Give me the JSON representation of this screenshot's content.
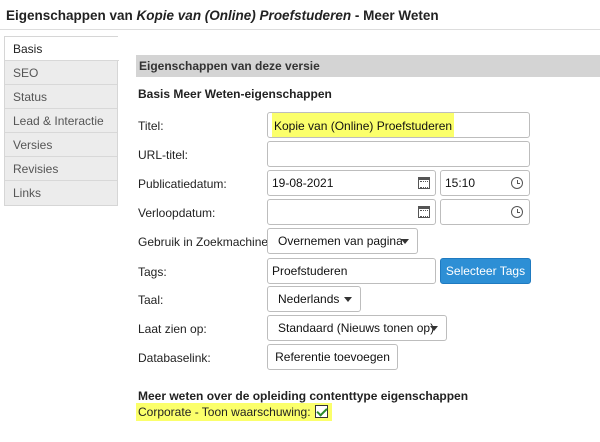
{
  "window": {
    "title_prefix": "Eigenschappen van ",
    "title_italic": "Kopie van (Online) Proefstuderen",
    "title_suffix": " - Meer Weten"
  },
  "sidebar": {
    "items": [
      {
        "label": "Basis",
        "active": true
      },
      {
        "label": "SEO",
        "active": false
      },
      {
        "label": "Status",
        "active": false
      },
      {
        "label": "Lead & Interactie",
        "active": false
      },
      {
        "label": "Versies",
        "active": false
      },
      {
        "label": "Revisies",
        "active": false
      },
      {
        "label": "Links",
        "active": false
      }
    ]
  },
  "main": {
    "section_header": "Eigenschappen van deze versie",
    "subheading": "Basis Meer Weten-eigenschappen",
    "fields": {
      "titel": {
        "label": "Titel:",
        "value": "Kopie van (Online) Proefstuderen"
      },
      "url_titel": {
        "label": "URL-titel:",
        "value": ""
      },
      "publicatiedatum": {
        "label": "Publicatiedatum:",
        "date": "19-08-2021",
        "time": "15:10"
      },
      "verloopdatum": {
        "label": "Verloopdatum:",
        "date": "",
        "time": ""
      },
      "zoekmachine": {
        "label": "Gebruik in Zoekmachine:",
        "value": "Overnemen van pagina"
      },
      "tags": {
        "label": "Tags:",
        "value": "Proefstuderen",
        "button": "Selecteer Tags"
      },
      "taal": {
        "label": "Taal:",
        "value": "Nederlands"
      },
      "laat_zien_op": {
        "label": "Laat zien op:",
        "value": "Standaard (Nieuws tonen op)"
      },
      "databaselink": {
        "label": "Databaselink:",
        "button": "Referentie toevoegen"
      }
    },
    "extra_section": {
      "heading": "Meer weten over de opleiding contenttype eigenschappen",
      "checkbox_label": "Corporate - Toon waarschuwing:",
      "checked": true
    }
  },
  "colors": {
    "highlight": "#fbff6b",
    "primary_button": "#2d8fd5",
    "section_header_bg": "#d4d4d4",
    "sidebar_bg": "#ececec"
  }
}
